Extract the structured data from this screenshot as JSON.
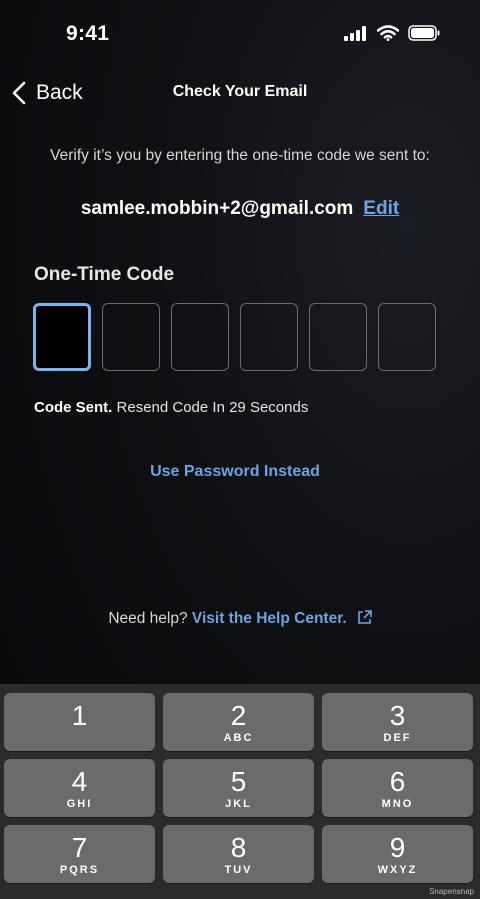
{
  "status_bar": {
    "time": "9:41"
  },
  "nav": {
    "back_label": "Back",
    "title": "Check Your Email"
  },
  "verify": {
    "instruction": "Verify it’s you by entering the one-time code we sent to:",
    "email": "samlee.mobbin+2@gmail.com",
    "edit_label": "Edit"
  },
  "code": {
    "label": "One-Time Code",
    "boxes": [
      "",
      "",
      "",
      "",
      "",
      ""
    ]
  },
  "resend": {
    "sent_label": "Code Sent.",
    "countdown_text": "Resend Code In 29 Seconds"
  },
  "use_password_label": "Use Password Instead",
  "help": {
    "prompt": "Need help?",
    "link_label": "Visit the Help Center."
  },
  "keypad": {
    "keys": [
      {
        "num": "1",
        "letters": ""
      },
      {
        "num": "2",
        "letters": "ABC"
      },
      {
        "num": "3",
        "letters": "DEF"
      },
      {
        "num": "4",
        "letters": "GHI"
      },
      {
        "num": "5",
        "letters": "JKL"
      },
      {
        "num": "6",
        "letters": "MNO"
      },
      {
        "num": "7",
        "letters": "PQRS"
      },
      {
        "num": "8",
        "letters": "TUV"
      },
      {
        "num": "9",
        "letters": "WXYZ"
      }
    ]
  },
  "watermark": "Snapensnap",
  "colors": {
    "accent": "#6fa3e0",
    "active_border": "#7bb4ee",
    "key_bg": "#6b6b6b",
    "keypad_bg": "#2b2b2b"
  }
}
